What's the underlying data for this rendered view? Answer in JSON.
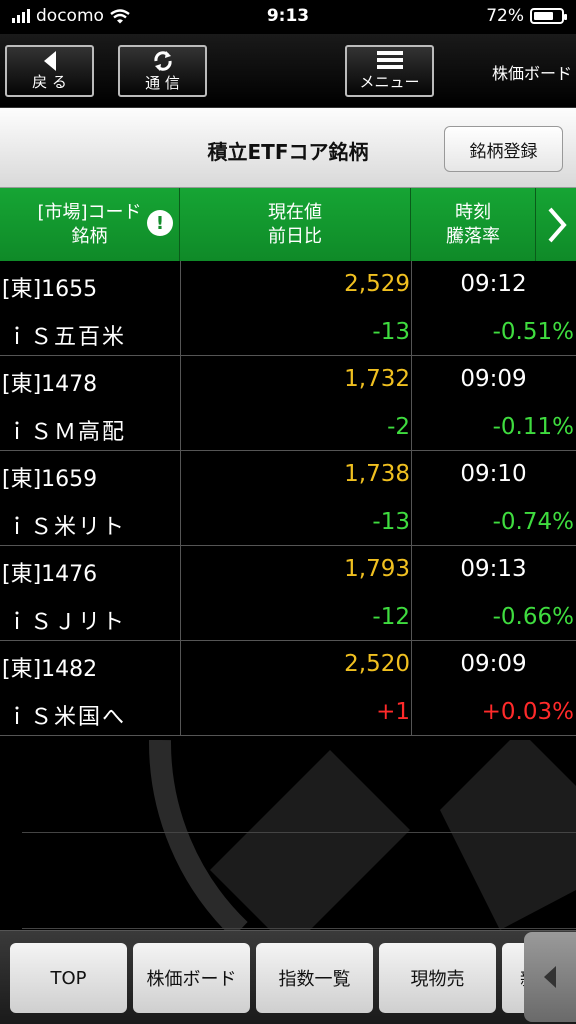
{
  "status_bar": {
    "carrier": "docomo",
    "time": "9:13",
    "battery": "72%",
    "battery_level": 0.72
  },
  "nav": {
    "back_label": "戻 る",
    "comm_label": "通 信",
    "menu_label": "メニュー",
    "screen_name": "株価ボード"
  },
  "page": {
    "title": "積立ETFコア銘柄",
    "register_button": "銘柄登録"
  },
  "columns": {
    "col1_line1": "[市場]コード",
    "col1_line2": "銘柄",
    "col2_line1": "現在値",
    "col2_line2": "前日比",
    "col3_line1": "時刻",
    "col3_line2": "騰落率"
  },
  "rows": [
    {
      "code": "[東]1655",
      "name": "ｉＳ五百米",
      "price": "2,529",
      "change": "-13",
      "time": "09:12",
      "pct": "-0.51%",
      "dir": "down"
    },
    {
      "code": "[東]1478",
      "name": "ｉＳＭ高配",
      "price": "1,732",
      "change": "-2",
      "time": "09:09",
      "pct": "-0.11%",
      "dir": "down"
    },
    {
      "code": "[東]1659",
      "name": "ｉＳ米リト",
      "price": "1,738",
      "change": "-13",
      "time": "09:10",
      "pct": "-0.74%",
      "dir": "down"
    },
    {
      "code": "[東]1476",
      "name": "ｉＳＪリト",
      "price": "1,793",
      "change": "-12",
      "time": "09:13",
      "pct": "-0.66%",
      "dir": "down"
    },
    {
      "code": "[東]1482",
      "name": "ｉＳ米国へ",
      "price": "2,520",
      "change": "+1",
      "time": "09:09",
      "pct": "+0.03%",
      "dir": "up"
    }
  ],
  "tabs": {
    "t1": "TOP",
    "t2": "株価ボード",
    "t3": "指数一覧",
    "t4": "現物売",
    "t5": "新"
  },
  "colors": {
    "header_green": "#16a534",
    "price_yellow": "#f0c020",
    "down_green": "#3fdc3f",
    "up_red": "#ff2a2a"
  }
}
